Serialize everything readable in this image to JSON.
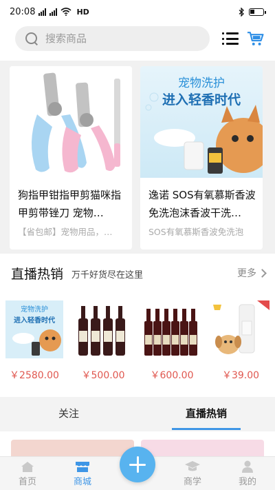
{
  "status": {
    "time": "20:08",
    "network": "HD",
    "icons": [
      "signal-icon",
      "signal-icon",
      "wifi-icon",
      "bluetooth-icon",
      "battery-icon"
    ]
  },
  "search": {
    "placeholder": "搜索商品"
  },
  "products": [
    {
      "title": "狗指甲钳指甲剪猫咪指甲剪带锉刀 宠物…",
      "desc": "【省包邮】宠物用品，…",
      "image": "nail-clipper-image"
    },
    {
      "title": "逸诺 SOS有氧慕斯香波免洗泡沫香波干洗…",
      "desc": "SOS有氧慕斯香波免洗泡",
      "image": "shampoo-banner-image",
      "banner_line1": "宠物洗护",
      "banner_line2": "进入轻香时代"
    }
  ],
  "live": {
    "title": "直播热销",
    "subtitle": "万千好货尽在这里",
    "more": "更多",
    "items": [
      {
        "price": "￥2580.00",
        "image": "pet-wash-banner-thumb",
        "banner_line1": "宠物洗护",
        "banner_line2": "进入轻香时代"
      },
      {
        "price": "￥500.00",
        "image": "red-wine-bottles-thumb"
      },
      {
        "price": "￥600.00",
        "image": "red-wine-bottles-thumb"
      },
      {
        "price": "￥39.00",
        "image": "puppy-shampoo-thumb"
      }
    ]
  },
  "tabs": [
    {
      "label": "关注"
    },
    {
      "label": "直播热销",
      "active": true
    }
  ],
  "nav": [
    {
      "label": "首页",
      "icon": "home-icon"
    },
    {
      "label": "商城",
      "icon": "shop-icon",
      "active": true
    },
    {
      "label": "",
      "icon": "add-icon"
    },
    {
      "label": "商学",
      "icon": "graduation-cap-icon"
    },
    {
      "label": "我的",
      "icon": "user-icon"
    }
  ],
  "colors": {
    "accent": "#3f96e6",
    "price": "#e0574f",
    "fab": "#58b3ef"
  }
}
